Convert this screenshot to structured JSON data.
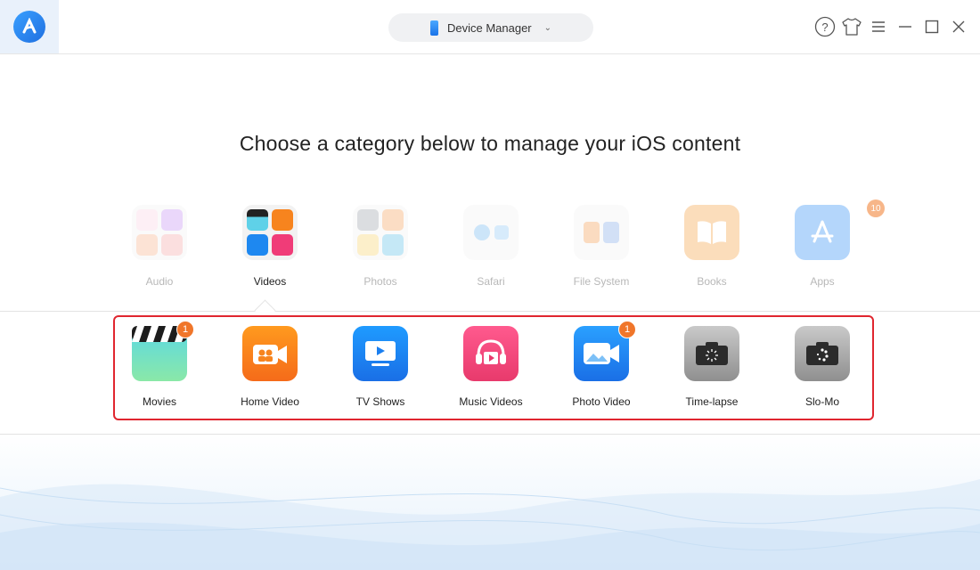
{
  "titlebar": {
    "device_selector": "Device Manager"
  },
  "heading": "Choose a category below to manage your iOS content",
  "categories": [
    {
      "label": "Audio",
      "active": false
    },
    {
      "label": "Videos",
      "active": true
    },
    {
      "label": "Photos",
      "active": false
    },
    {
      "label": "Safari",
      "active": false
    },
    {
      "label": "File System",
      "active": false
    },
    {
      "label": "Books",
      "active": false
    },
    {
      "label": "Apps",
      "active": false,
      "badge": "10"
    }
  ],
  "subcategories": [
    {
      "label": "Movies",
      "badge": "1"
    },
    {
      "label": "Home Video"
    },
    {
      "label": "TV Shows"
    },
    {
      "label": "Music Videos"
    },
    {
      "label": "Photo Video",
      "badge": "1"
    },
    {
      "label": "Time-lapse"
    },
    {
      "label": "Slo-Mo"
    }
  ],
  "colors": {
    "highlight_border": "#e0262f",
    "badge": "#f0762a",
    "accent": "#1f6fe0"
  }
}
